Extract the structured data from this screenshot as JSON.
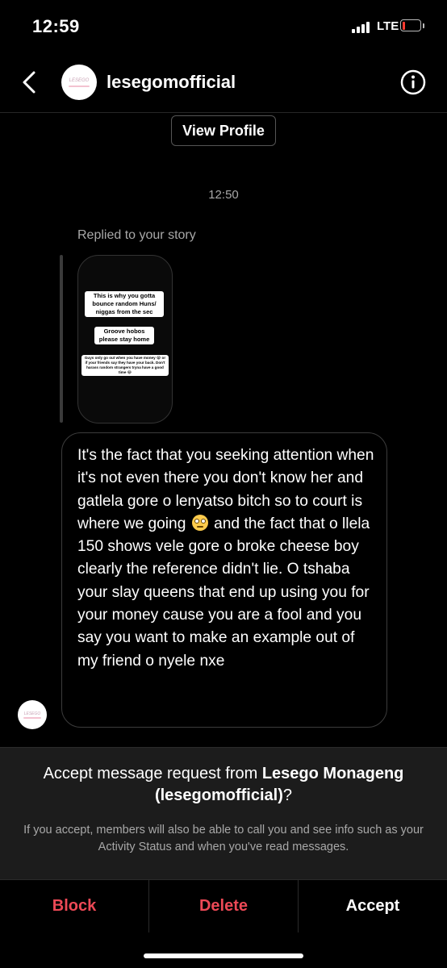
{
  "status_bar": {
    "time": "12:59",
    "network": "LTE"
  },
  "header": {
    "username": "lesegomofficial",
    "avatar_text": "LESEGO"
  },
  "view_profile_label": "View Profile",
  "thread": {
    "timestamp": "12:50",
    "replied_label": "Replied to your story",
    "story": {
      "caption1": "This is why you gotta bounce random Huns/ niggas from the sec",
      "caption2": "Groove hobos please stay home",
      "caption3": "Guys only go out when you have money 😭 or if your friends say they have your back. Don't harass random strangers tryna have a good time 😂"
    },
    "message_part1": "It's the fact that you seeking attention when it's not even there you don't know her and gatlela gore o lenyatso bitch so to court is where we going",
    "message_part2": "and the fact that o llela 150 shows vele gore o broke cheese boy clearly the reference didn't lie. O tshaba your slay queens that end up using you for your money cause you are a fool and you say you want to make an example out of my friend o nyele nxe",
    "emoji": "rolling-eyes-emoji"
  },
  "request": {
    "title_prefix": "Accept message request from ",
    "sender_name": "Lesego Monageng",
    "sender_handle": "(lesegomofficial)",
    "title_suffix": "?",
    "description": "If you accept, members will also be able to call you and see info such as your Activity Status and when you've read messages."
  },
  "actions": {
    "block": "Block",
    "delete": "Delete",
    "accept": "Accept"
  },
  "colors": {
    "destructive": "#ed4956",
    "background": "#000000",
    "panel": "#1c1c1c"
  }
}
